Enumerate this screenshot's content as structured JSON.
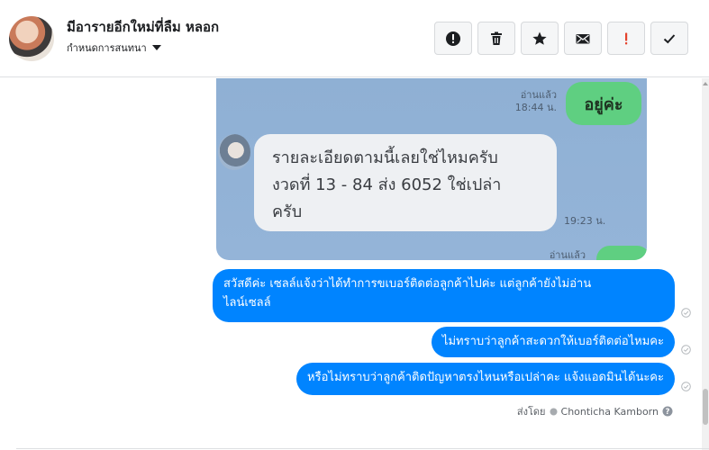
{
  "header": {
    "title": "มีอารายอีกใหม่ที่ลืม หลอก",
    "subtitle": "กำหนดการสนทนา",
    "toolbar": [
      {
        "name": "report-button",
        "icon": "exclamation-circle-icon"
      },
      {
        "name": "delete-button",
        "icon": "trash-icon"
      },
      {
        "name": "star-button",
        "icon": "star-icon"
      },
      {
        "name": "mark-unread-button",
        "icon": "envelope-icon"
      },
      {
        "name": "important-button",
        "icon": "exclamation-icon",
        "color": "#e4432d"
      },
      {
        "name": "done-button",
        "icon": "check-icon"
      }
    ]
  },
  "attachment": {
    "read_label_1": "อ่านแล้ว",
    "time_1": "18:44 น.",
    "reply_text": "อยู่ค่ะ",
    "bubble_line_1": "รายละเอียดตามนี้เลยใช่ไหมครับ",
    "bubble_line_2": "งวดที่ 13 - 84 ส่ง 6052 ใช่เปล่า",
    "bubble_line_3": "ครับ",
    "time_2": "19:23 น.",
    "read_label_2": "อ่านแล้ว"
  },
  "messages": [
    {
      "line_1": "สวัสดีค่ะ เซลล์แจ้งว่าได้ทำการขเบอร์ติดต่อลูกค้าไปค่ะ แต่ลูกค้ายังไม่อ่าน",
      "line_2": "ไลน์เซลล์"
    },
    {
      "text": "ไม่ทราบว่าลูกค้าสะดวกให้เบอร์ติดต่อไหมคะ"
    },
    {
      "text": "หรือไม่ทราบว่าลูกค้าติดปัญหาตรงไหนหรือเปล่าคะ แจ้งแอดมินได้นะคะ"
    }
  ],
  "sent_by": {
    "label": "ส่งโดย",
    "name": "Chonticha Kamborn"
  },
  "colors": {
    "bubble": "#0084ff",
    "line_green": "#5fcf81",
    "important": "#e4432d"
  }
}
